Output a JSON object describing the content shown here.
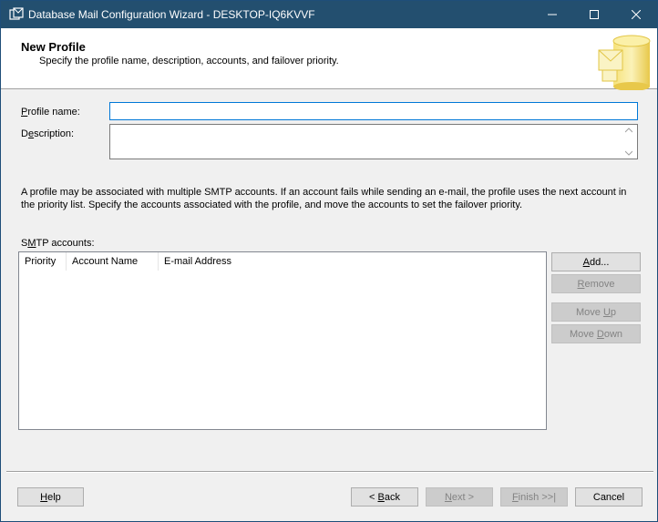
{
  "window": {
    "title": "Database Mail Configuration Wizard - DESKTOP-IQ6KVVF",
    "icon": "database-mail-icon",
    "controls": {
      "minimize": "minimize-icon",
      "maximize": "maximize-icon",
      "close": "close-icon"
    },
    "titlebar_color": "#234f6f"
  },
  "header": {
    "title": "New Profile",
    "subtitle": "Specify the profile name, description, accounts, and failover priority.",
    "graphic": "database-mail-graphic"
  },
  "form": {
    "profile_name_label_accel": "P",
    "profile_name_label_rest": "rofile name:",
    "profile_name_value": "",
    "description_label_pre": "D",
    "description_label_accel": "e",
    "description_label_rest": "scription:",
    "description_value": ""
  },
  "info_text": "A profile may be associated with multiple SMTP accounts. If an account fails while sending an e-mail, the profile uses the next account in the priority list. Specify the accounts associated with the profile, and move the accounts to set the failover priority.",
  "smtp": {
    "label_pre": "S",
    "label_accel": "M",
    "label_rest": "TP accounts:",
    "columns": [
      "Priority",
      "Account Name",
      "E-mail Address"
    ],
    "rows": []
  },
  "side_buttons": {
    "add_accel": "A",
    "add_rest": "dd...",
    "remove_accel": "R",
    "remove_rest": "emove",
    "move_up_pre": "Move ",
    "move_up_accel": "U",
    "move_up_rest": "p",
    "move_down_pre": "Move ",
    "move_down_accel": "D",
    "move_down_rest": "own"
  },
  "footer": {
    "help_accel": "H",
    "help_rest": "elp",
    "back_pre": "< ",
    "back_accel": "B",
    "back_rest": "ack",
    "next_accel": "N",
    "next_rest": "ext >",
    "finish_accel": "F",
    "finish_rest": "inish >>|",
    "cancel": "Cancel"
  }
}
